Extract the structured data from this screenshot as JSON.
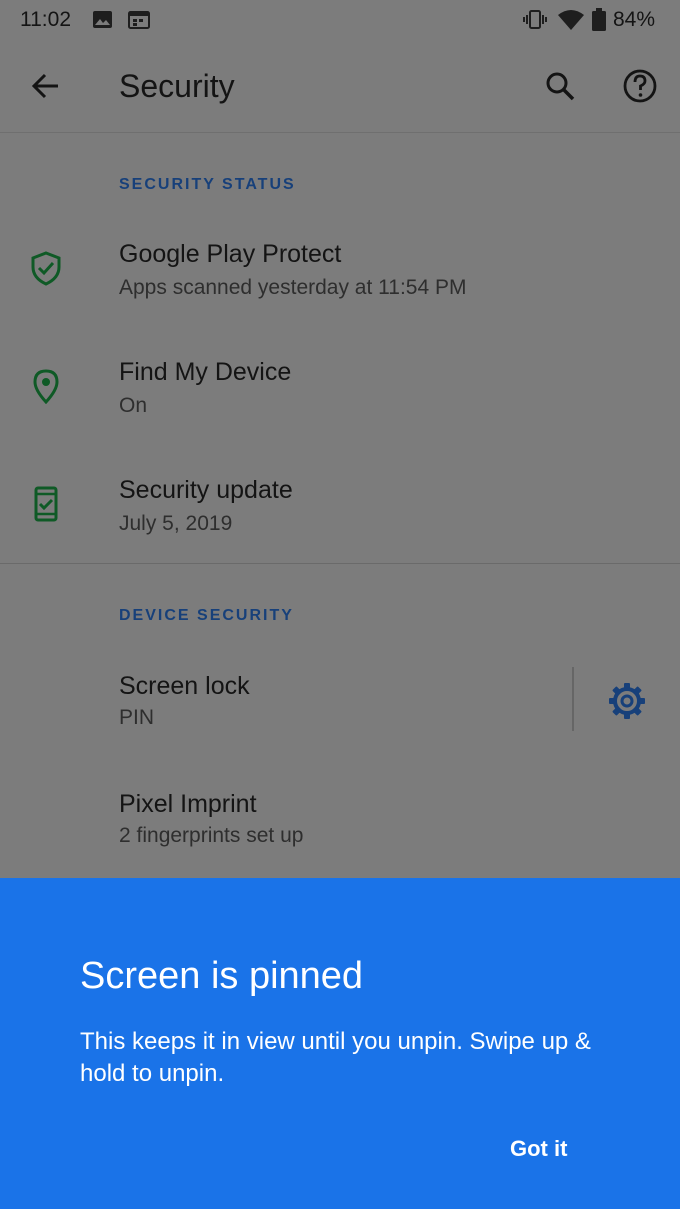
{
  "status_bar": {
    "time": "11:02",
    "battery": "84%",
    "icons": [
      "image-icon",
      "calendar-icon",
      "vibrate-icon",
      "wifi-icon",
      "battery-icon"
    ]
  },
  "app_bar": {
    "title": "Security",
    "icons": [
      "back-arrow-icon",
      "search-icon",
      "help-icon"
    ]
  },
  "sections": {
    "security_status": {
      "header": "SECURITY STATUS",
      "items": [
        {
          "title": "Google Play Protect",
          "subtitle": "Apps scanned yesterday at 11:54 PM",
          "icon": "shield-check-icon"
        },
        {
          "title": "Find My Device",
          "subtitle": "On",
          "icon": "location-pin-icon"
        },
        {
          "title": "Security update",
          "subtitle": "July 5, 2019",
          "icon": "phone-check-icon"
        }
      ]
    },
    "device_security": {
      "header": "DEVICE SECURITY",
      "items": [
        {
          "title": "Screen lock",
          "subtitle": "PIN",
          "action_icon": "gear-icon"
        },
        {
          "title": "Pixel Imprint",
          "subtitle": "2 fingerprints set up"
        }
      ]
    }
  },
  "pin_panel": {
    "title": "Screen is pinned",
    "body": "This keeps it in view until you unpin. Swipe up & hold to unpin.",
    "button": "Got it"
  },
  "colors": {
    "dimmed_background": "#7c7c7c",
    "panel_blue": "#1a73e8",
    "icon_green": "#0f5a26",
    "accent_blue": "#17407a"
  }
}
